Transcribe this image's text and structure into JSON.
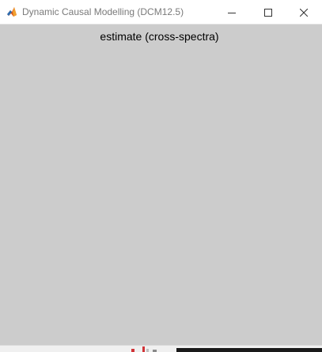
{
  "window": {
    "title": "Dynamic Causal Modelling (DCM12.5)",
    "app_icon": "matlab-icon",
    "controls": {
      "minimize_icon": "minimize-icon",
      "maximize_icon": "maximize-icon",
      "close_icon": "close-icon"
    }
  },
  "figure": {
    "title": "estimate (cross-spectra)",
    "background_color": "#cccccc"
  },
  "taskbar": {
    "icons": [
      "taskbar-app-icon",
      "taskbar-app-icon",
      "taskbar-app-icon",
      "taskbar-app-icon"
    ]
  }
}
